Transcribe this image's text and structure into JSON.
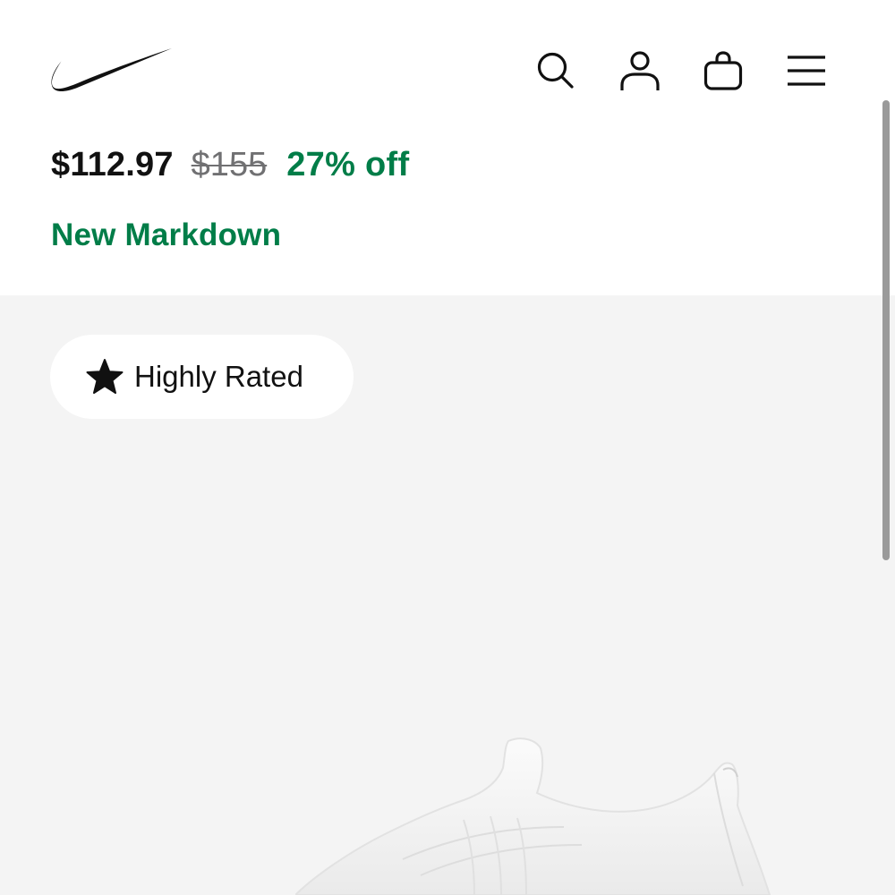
{
  "header": {
    "logo": "nike-swoosh",
    "icons": {
      "search": "search-icon",
      "account": "person-icon",
      "bag": "bag-icon",
      "menu": "hamburger-menu-icon"
    }
  },
  "product": {
    "price_current": "$112.97",
    "price_original": "$155",
    "discount": "27% off",
    "markdown_label": "New Markdown"
  },
  "gallery": {
    "badge": {
      "icon": "star-icon",
      "label": "Highly Rated"
    }
  },
  "colors": {
    "text": "#111111",
    "discount_green": "#007d48",
    "strike_gray": "#707072",
    "gallery_bg": "#f4f4f4",
    "page_bg": "#ffffff"
  }
}
